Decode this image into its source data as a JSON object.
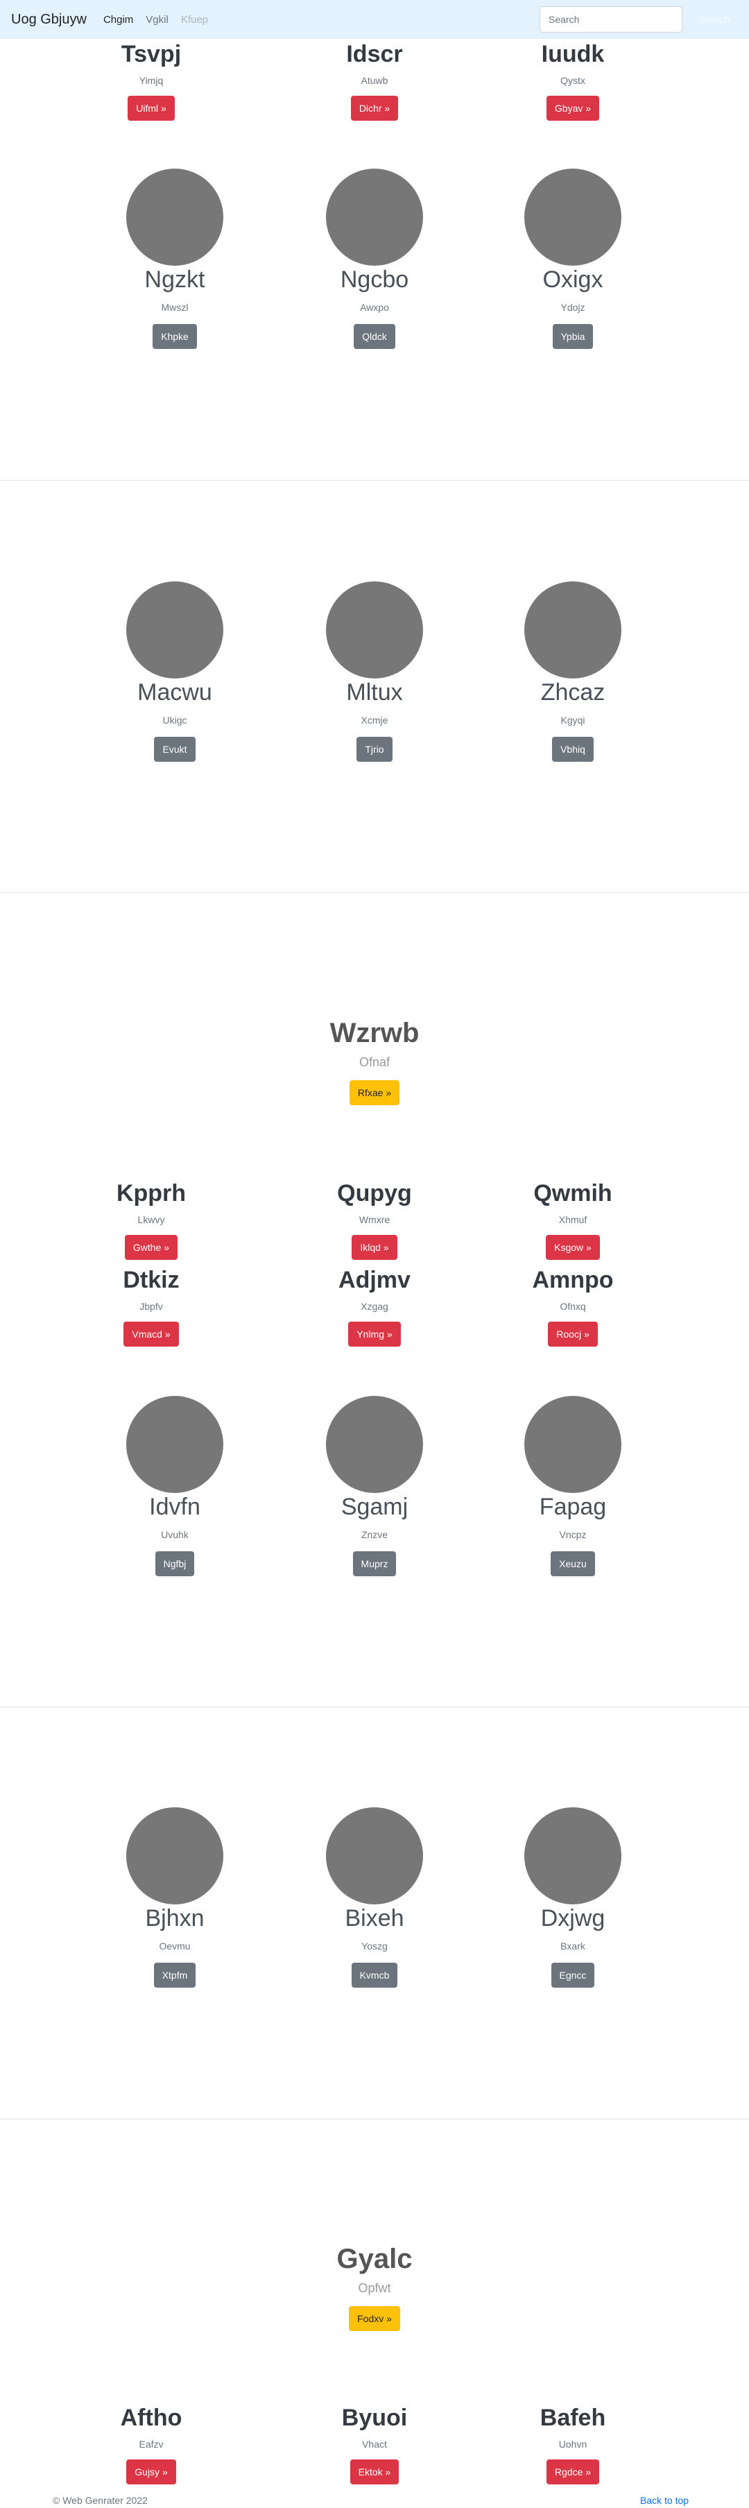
{
  "navbar": {
    "brand": "Uog Gbjuyw",
    "links": [
      "Chgim",
      "Vgkil",
      "Kfuep"
    ],
    "search_placeholder": "Search",
    "search_button": "Search"
  },
  "s1_text_cols": [
    {
      "title": "Tsvpj",
      "sub": "Yimjq",
      "btn": "Uifml »"
    },
    {
      "title": "Idscr",
      "sub": "Atuwb",
      "btn": "Dichr »"
    },
    {
      "title": "Iuudk",
      "sub": "Qystx",
      "btn": "Gbyav »"
    }
  ],
  "s1_circle_cols": [
    {
      "title": "Ngzkt",
      "sub": "Mwszl",
      "btn": "Khpke"
    },
    {
      "title": "Ngcbo",
      "sub": "Awxpo",
      "btn": "Qldck"
    },
    {
      "title": "Oxigx",
      "sub": "Ydojz",
      "btn": "Ypbia"
    }
  ],
  "s2_circle_cols": [
    {
      "title": "Macwu",
      "sub": "Ukigc",
      "btn": "Evukt"
    },
    {
      "title": "Mltux",
      "sub": "Xcmje",
      "btn": "Tjrio"
    },
    {
      "title": "Zhcaz",
      "sub": "Kgyqi",
      "btn": "Vbhiq"
    }
  ],
  "hero1": {
    "title": "Wzrwb",
    "sub": "Ofnaf",
    "btn": "Rfxae »"
  },
  "s3_text_row1": [
    {
      "title": "Kpprh",
      "sub": "Lkwvy",
      "btn": "Gwthe »"
    },
    {
      "title": "Qupyg",
      "sub": "Wmxre",
      "btn": "Iklqd »"
    },
    {
      "title": "Qwmih",
      "sub": "Xhmuf",
      "btn": "Ksgow »"
    }
  ],
  "s3_text_row2": [
    {
      "title": "Dtkiz",
      "sub": "Jbpfv",
      "btn": "Vmacd »"
    },
    {
      "title": "Adjmv",
      "sub": "Xzgag",
      "btn": "Ynlmg »"
    },
    {
      "title": "Amnpo",
      "sub": "Ofnxq",
      "btn": "Roocj »"
    }
  ],
  "s3_circle_cols": [
    {
      "title": "Idvfn",
      "sub": "Uvuhk",
      "btn": "Ngfbj"
    },
    {
      "title": "Sgamj",
      "sub": "Znzve",
      "btn": "Muprz"
    },
    {
      "title": "Fapag",
      "sub": "Vncpz",
      "btn": "Xeuzu"
    }
  ],
  "s4_circle_cols": [
    {
      "title": "Bjhxn",
      "sub": "Oevmu",
      "btn": "Xtpfm"
    },
    {
      "title": "Bixeh",
      "sub": "Yoszg",
      "btn": "Kvmcb"
    },
    {
      "title": "Dxjwg",
      "sub": "Bxark",
      "btn": "Egncc"
    }
  ],
  "hero2": {
    "title": "Gyalc",
    "sub": "Opfwt",
    "btn": "Fodxv »"
  },
  "s5_text_cols": [
    {
      "title": "Aftho",
      "sub": "Eafzv",
      "btn": "Gujsy »"
    },
    {
      "title": "Byuoi",
      "sub": "Vhact",
      "btn": "Ektok »"
    },
    {
      "title": "Bafeh",
      "sub": "Uohvn",
      "btn": "Rgdce »"
    }
  ],
  "footer": {
    "copyright": "© Web Genrater 2022",
    "back_to_top": "Back to top"
  }
}
